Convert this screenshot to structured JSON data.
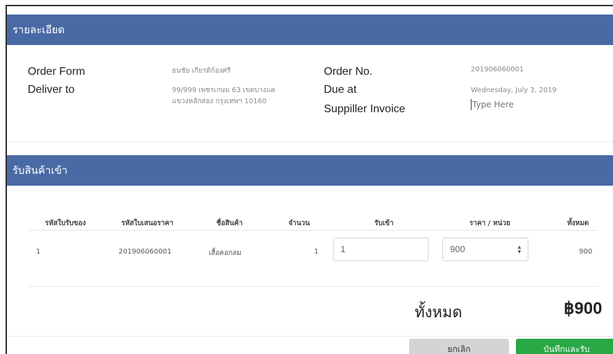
{
  "details": {
    "header": "รายละเอียด",
    "order_form_label": "Order Form",
    "order_form_value": "ธนชัย เกียรติก้องศรี",
    "deliver_to_label": "Deliver to",
    "deliver_to_line1": "99/999 เพชรเกษม 63 เขตบางแค",
    "deliver_to_line2": "แขวงหลักสอง กรุงเทพฯ 10160",
    "order_no_label": "Order No.",
    "order_no_value": "201906060001",
    "due_at_label": "Due at",
    "due_at_value": "Wednesday, July 3, 2019",
    "supplier_invoice_label": "Suppiller Invoice",
    "supplier_invoice_placeholder": "Type Here"
  },
  "receive": {
    "header": "รับสินค้าเข้า",
    "columns": [
      "รหัสใบรับของ",
      "รหัสใบเสนอราคา",
      "ชื่อสินค้า",
      "จำนวน",
      "รับเข้า",
      "ราคา / หน่วย",
      "ทั้งหมด"
    ],
    "rows": [
      {
        "receipt_code": "1",
        "quote_code": "201906060001",
        "product": "เสื้อคอกลม",
        "quantity": "1",
        "received": "1",
        "unit_price": "900",
        "total": "900"
      }
    ],
    "total_label": "ทั้งหมด",
    "total_value": "฿900"
  },
  "buttons": {
    "cancel": "ยกเลิก",
    "save": "บันทึกและรับ"
  },
  "colors": {
    "header_bg": "#4a6aa5",
    "save_button": "#28a745",
    "cancel_button": "#d4d4d4"
  }
}
